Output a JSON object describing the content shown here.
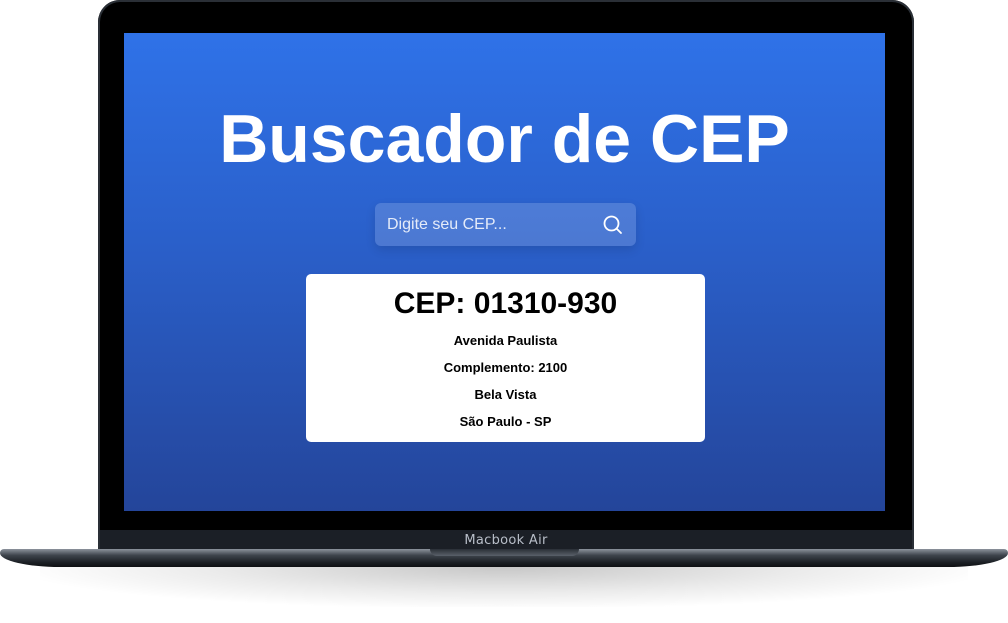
{
  "device": {
    "label": "Macbook Air"
  },
  "app": {
    "title": "Buscador de CEP",
    "search": {
      "value": "",
      "placeholder": "Digite seu CEP...",
      "button_icon": "search-icon"
    },
    "result": {
      "cep_heading": "CEP: 01310-930",
      "street": "Avenida Paulista",
      "complement": "Complemento: 2100",
      "neighborhood": "Bela Vista",
      "city_state": "São Paulo - SP"
    }
  },
  "colors": {
    "gradient_top": "#2f72e8",
    "gradient_bottom": "#24459a",
    "card_background": "#ffffff",
    "title_text": "#ffffff"
  }
}
